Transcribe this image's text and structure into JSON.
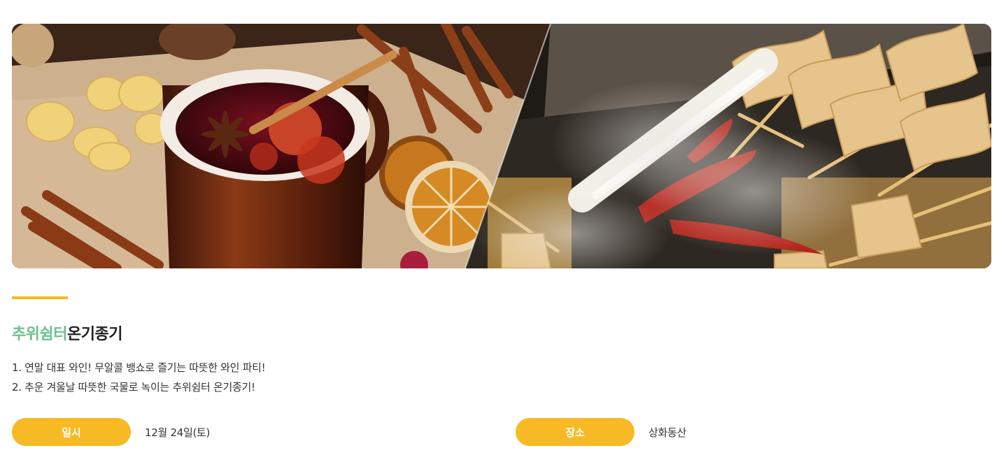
{
  "banner": {
    "left_image": "mulled-wine-photo",
    "right_image": "fish-cake-skewers-photo"
  },
  "event": {
    "title_highlight": "추위쉼터",
    "title_rest": "온기종기",
    "descriptions": [
      "1. 연말 대표 와인! 무알콜 뱅쇼로 즐기는 따뜻한 와인 파티!",
      "2. 추운 겨울날 따뜻한 국물로 녹이는 추위쉼터 온기종기!"
    ],
    "date_label": "일시",
    "date_value": "12월 24일(토)",
    "place_label": "장소",
    "place_value": "상화동산"
  },
  "colors": {
    "accent_yellow": "#f7b924",
    "title_green": "#6cc08f",
    "text_dark": "#222222"
  }
}
